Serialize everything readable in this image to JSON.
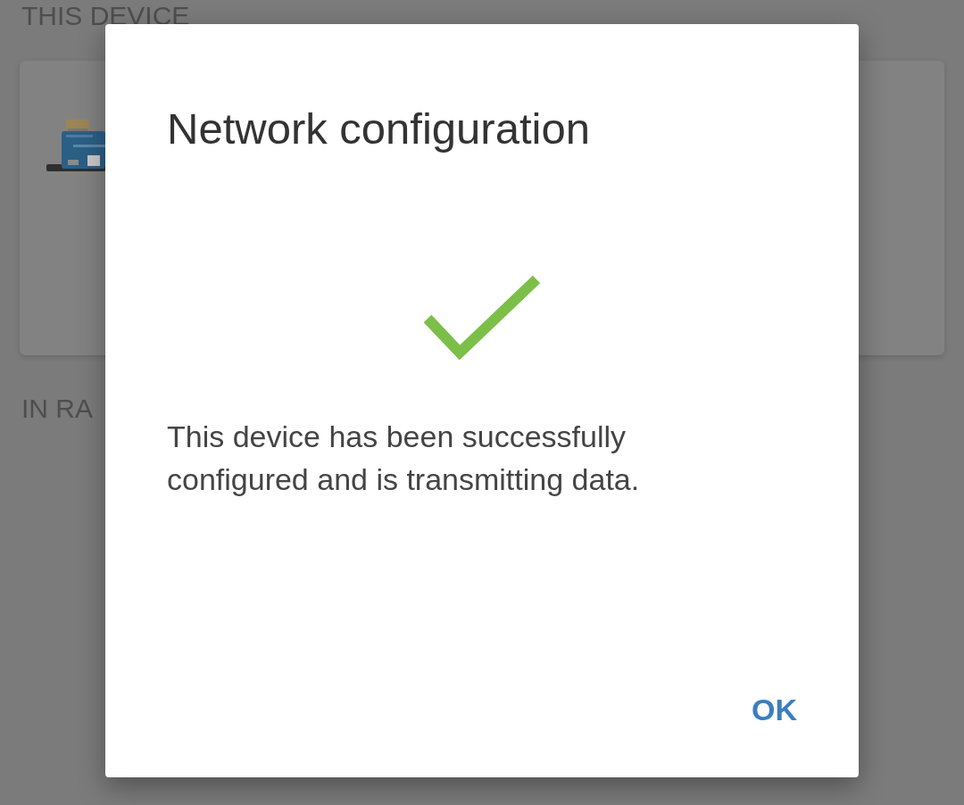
{
  "background": {
    "section_title": "THIS DEVICE",
    "section_title_2": "IN RA"
  },
  "dialog": {
    "title": "Network configuration",
    "icon": {
      "kind": "checkmark"
    },
    "message": "This device has been successfully configured and is transmitting data.",
    "buttons": [
      "OK"
    ]
  }
}
